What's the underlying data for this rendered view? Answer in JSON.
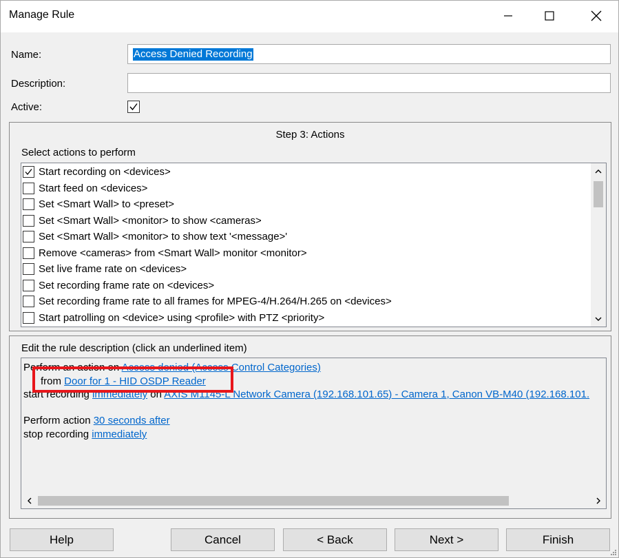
{
  "window": {
    "title": "Manage Rule",
    "controls": [
      "minimize-icon",
      "maximize-icon",
      "close-icon"
    ]
  },
  "form": {
    "name_label": "Name:",
    "name_value": "Access Denied Recording",
    "description_label": "Description:",
    "description_value": "",
    "active_label": "Active:",
    "active_checked": true
  },
  "actions_group": {
    "step_title": "Step 3: Actions",
    "select_label": "Select actions to perform",
    "items": [
      {
        "label": "Start recording on <devices>",
        "checked": true
      },
      {
        "label": "Start feed on <devices>",
        "checked": false
      },
      {
        "label": "Set <Smart Wall> to <preset>",
        "checked": false
      },
      {
        "label": "Set <Smart Wall> <monitor> to show <cameras>",
        "checked": false
      },
      {
        "label": "Set <Smart Wall> <monitor> to show text '<message>'",
        "checked": false
      },
      {
        "label": "Remove <cameras> from <Smart Wall> monitor <monitor>",
        "checked": false
      },
      {
        "label": "Set live frame rate on <devices>",
        "checked": false
      },
      {
        "label": "Set recording frame rate on <devices>",
        "checked": false
      },
      {
        "label": "Set recording frame rate to all frames for MPEG-4/H.264/H.265 on <devices>",
        "checked": false
      },
      {
        "label": "Start patrolling on <device> using <profile> with PTZ <priority>",
        "checked": false
      }
    ]
  },
  "rule_description": {
    "header": "Edit the rule description (click an underlined item)",
    "line1_text": "Perform an action on ",
    "line1_link": "Access denied (Access Control Categories)",
    "line2_text": "from ",
    "line2_link": "Door for 1 - HID OSDP Reader",
    "line3_text": "start recording ",
    "line3_link1": "immediately",
    "line3_mid": " on ",
    "line3_link2": "AXIS M1145-L Network Camera (192.168.101.65) - Camera 1, Canon VB-M40 (192.168.101.",
    "line4_text": "Perform action ",
    "line4_link": "30 seconds after",
    "line5_text": "stop recording ",
    "line5_link": "immediately"
  },
  "buttons": {
    "help": "Help",
    "cancel": "Cancel",
    "back": "< Back",
    "next": "Next >",
    "finish": "Finish"
  },
  "colors": {
    "accent_selection": "#0078d7",
    "link": "#0066cc",
    "highlight_box": "#e8161b"
  }
}
